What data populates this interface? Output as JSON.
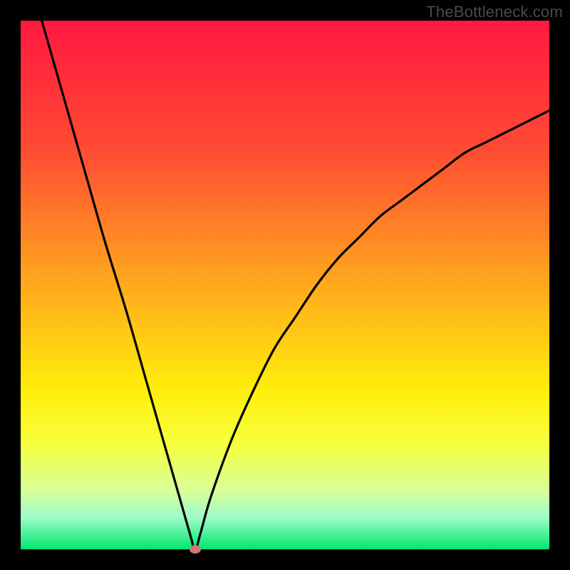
{
  "watermark": "TheBottleneck.com",
  "colors": {
    "frame": "#000000",
    "gradient_top": "#ff1940",
    "gradient_bottom": "#00e66c",
    "marker": "#cf7574",
    "curve": "#000000"
  },
  "chart_data": {
    "type": "line",
    "title": "",
    "xlabel": "",
    "ylabel": "",
    "xlim": [
      0,
      100
    ],
    "ylim": [
      0,
      100
    ],
    "x": [
      4,
      8,
      12,
      16,
      20,
      24,
      28,
      30,
      32,
      33,
      34,
      36,
      40,
      44,
      48,
      52,
      56,
      60,
      64,
      68,
      72,
      76,
      80,
      84,
      88,
      92,
      96,
      100
    ],
    "values": [
      100,
      86,
      72,
      58,
      45,
      31,
      17,
      10,
      3,
      0,
      3,
      10,
      21,
      30,
      38,
      44,
      50,
      55,
      59,
      63,
      66,
      69,
      72,
      75,
      77,
      79,
      81,
      83
    ],
    "marker": {
      "x": 33,
      "y": 0
    },
    "notes": "V-shaped bottleneck curve on red-to-green vertical gradient; axes unlabeled; values estimated from pixels"
  }
}
